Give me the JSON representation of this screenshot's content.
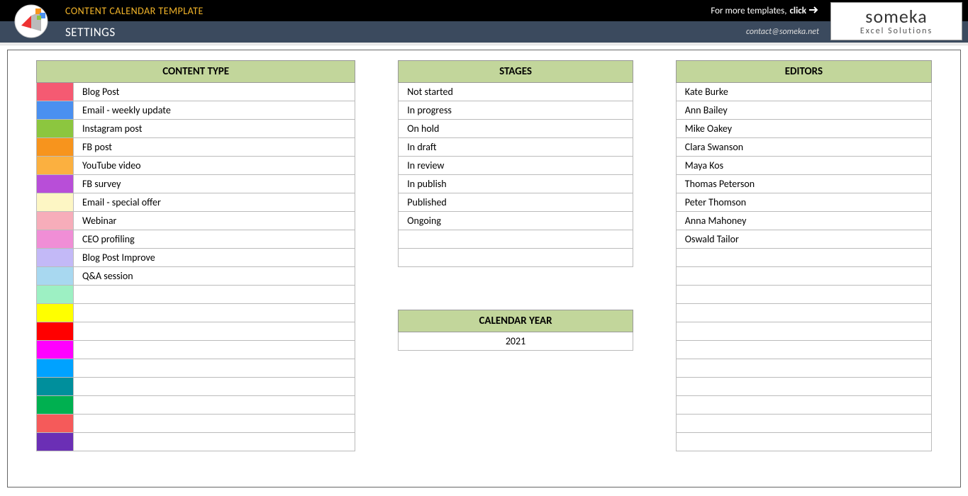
{
  "header": {
    "top_title": "CONTENT CALENDAR TEMPLATE",
    "more_templates_prefix": "For more templates, ",
    "more_templates_click": "click",
    "sub_title": "SETTINGS",
    "contact": "contact@someka.net",
    "brand_name": "someka",
    "brand_tag": "Excel Solutions"
  },
  "content_type": {
    "title": "CONTENT TYPE",
    "rows": [
      {
        "color": "#f55a72",
        "label": "Blog Post"
      },
      {
        "color": "#4a90f0",
        "label": "Email - weekly update"
      },
      {
        "color": "#8cc63f",
        "label": "Instagram post"
      },
      {
        "color": "#f7941d",
        "label": "FB post"
      },
      {
        "color": "#fbb040",
        "label": "YouTube video"
      },
      {
        "color": "#b84ed8",
        "label": "FB survey"
      },
      {
        "color": "#fdf6c4",
        "label": "Email - special offer"
      },
      {
        "color": "#f7adba",
        "label": "Webinar"
      },
      {
        "color": "#f08ed6",
        "label": "CEO profiling"
      },
      {
        "color": "#c3b9f7",
        "label": "Blog Post Improve"
      },
      {
        "color": "#a8d8f0",
        "label": "Q&A session"
      },
      {
        "color": "#9df0c3",
        "label": ""
      },
      {
        "color": "#ffff00",
        "label": ""
      },
      {
        "color": "#ff0000",
        "label": ""
      },
      {
        "color": "#ff00ff",
        "label": ""
      },
      {
        "color": "#00a2ff",
        "label": ""
      },
      {
        "color": "#008f9c",
        "label": ""
      },
      {
        "color": "#00b050",
        "label": ""
      },
      {
        "color": "#f55a5a",
        "label": ""
      },
      {
        "color": "#6b2fb5",
        "label": ""
      }
    ]
  },
  "stages": {
    "title": "STAGES",
    "rows": [
      "Not started",
      "In progress",
      "On hold",
      "In draft",
      "In review",
      "In publish",
      "Published",
      "Ongoing",
      "",
      ""
    ]
  },
  "calendar_year": {
    "title": "CALENDAR YEAR",
    "value": "2021"
  },
  "editors": {
    "title": "EDITORS",
    "rows": [
      "Kate Burke",
      "Ann Bailey",
      "Mike Oakey",
      "Clara Swanson",
      "Maya Kos",
      "Thomas Peterson",
      "Peter Thomson",
      "Anna Mahoney",
      "Oswald Tailor",
      "",
      "",
      "",
      "",
      "",
      "",
      "",
      "",
      "",
      "",
      ""
    ]
  }
}
